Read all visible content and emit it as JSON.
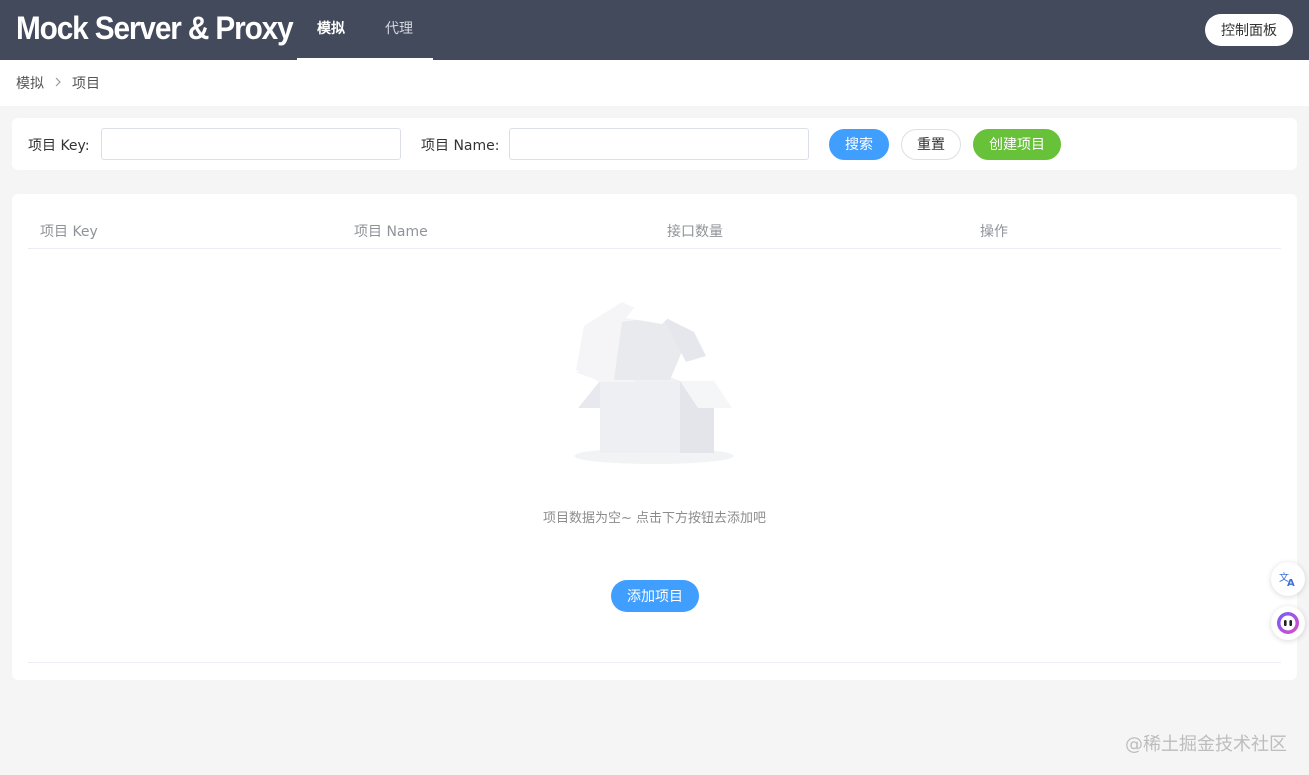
{
  "app": {
    "title": "Mock Server & Proxy"
  },
  "nav": {
    "tabs": [
      {
        "label": "模拟",
        "active": true
      },
      {
        "label": "代理",
        "active": false
      }
    ],
    "console_label": "控制面板"
  },
  "breadcrumb": {
    "items": [
      "模拟",
      "项目"
    ],
    "separator_icon": "chevron-right-icon"
  },
  "search": {
    "key_label": "项目 Key:",
    "key_value": "",
    "key_placeholder": "",
    "name_label": "项目 Name:",
    "name_value": "",
    "name_placeholder": "",
    "search_label": "搜索",
    "reset_label": "重置",
    "create_label": "创建项目"
  },
  "table": {
    "columns": [
      "项目 Key",
      "项目 Name",
      "接口数量",
      "操作"
    ],
    "rows": [],
    "empty_icon": "empty-box-icon",
    "empty_text": "项目数据为空~ 点击下方按钮去添加吧",
    "add_label": "添加项目"
  },
  "floating": {
    "translate_icon": "translate-icon",
    "assistant_icon": "assistant-icon"
  },
  "watermark": "@稀土掘金技术社区",
  "colors": {
    "header_bg": "#434a5c",
    "primary": "#409eff",
    "success": "#67c23a",
    "page_bg": "#f5f5f5"
  }
}
